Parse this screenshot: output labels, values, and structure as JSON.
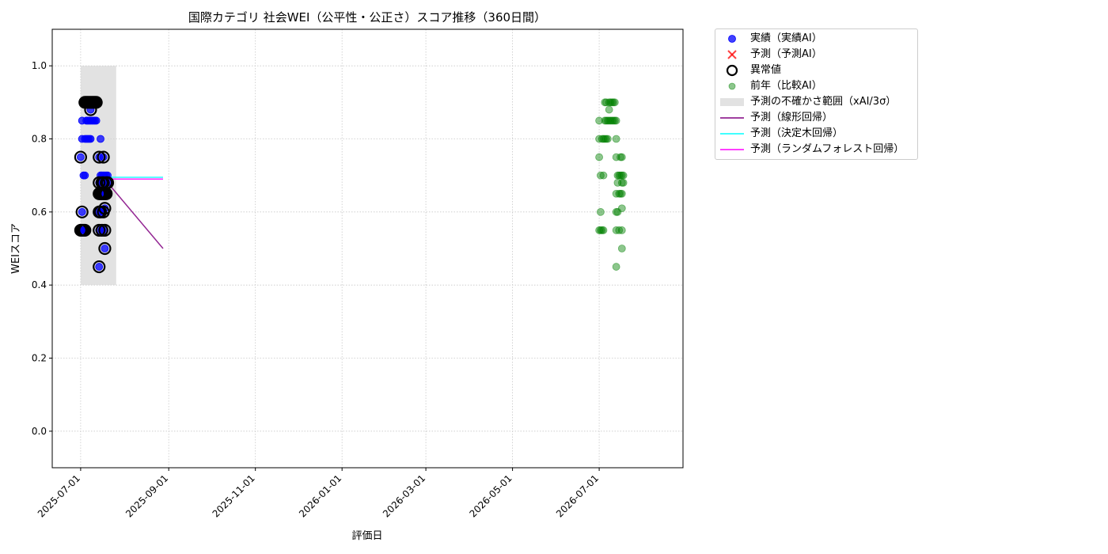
{
  "chart_data": {
    "type": "scatter",
    "title": "国際カテゴリ 社会WEI（公平性・公正さ）スコア推移（360日間）",
    "xlabel": "評価日",
    "ylabel": "WEIスコア",
    "ylim": [
      -0.1,
      1.1
    ],
    "yticks": [
      0.0,
      0.2,
      0.4,
      0.6,
      0.8,
      1.0
    ],
    "xlim": [
      "2025-06-11",
      "2026-08-29"
    ],
    "xticks": [
      "2025-07-01",
      "2025-09-01",
      "2025-11-01",
      "2026-01-01",
      "2026-03-01",
      "2026-05-01",
      "2026-07-01"
    ],
    "grid": true,
    "legend_position": "outside-right-top",
    "colors": {
      "actual": "#0000ff",
      "forecast": "#ff0000",
      "anomaly_edge": "#000000",
      "previous_year": "#008000",
      "uncertainty": "#d3d3d3",
      "linear": "#800080",
      "decision_tree": "#00ffff",
      "random_forest": "#ff00ff"
    },
    "uncertainty_band": {
      "x": [
        "2025-07-01",
        "2025-07-26"
      ],
      "y": [
        0.4,
        1.0
      ]
    },
    "legend": [
      {
        "key": "actual",
        "label": "実績（実績AI）"
      },
      {
        "key": "forecast",
        "label": "予測（予測AI）"
      },
      {
        "key": "anomaly",
        "label": "異常値"
      },
      {
        "key": "previous_year",
        "label": "前年（比較AI）"
      },
      {
        "key": "uncertainty",
        "label": "予測の不確かさ範囲（xAI/3σ）"
      },
      {
        "key": "linear",
        "label": "予測（線形回帰）"
      },
      {
        "key": "decision_tree",
        "label": "予測（決定木回帰）"
      },
      {
        "key": "random_forest",
        "label": "予測（ランダムフォレスト回帰）"
      }
    ],
    "series": [
      {
        "key": "actual",
        "points": [
          [
            "2025-07-01",
            0.75
          ],
          [
            "2025-07-01",
            0.55
          ],
          [
            "2025-07-02",
            0.85
          ],
          [
            "2025-07-02",
            0.8
          ],
          [
            "2025-07-02",
            0.55
          ],
          [
            "2025-07-02",
            0.6
          ],
          [
            "2025-07-03",
            0.7
          ],
          [
            "2025-07-03",
            0.55
          ],
          [
            "2025-07-04",
            0.9
          ],
          [
            "2025-07-04",
            0.8
          ],
          [
            "2025-07-04",
            0.7
          ],
          [
            "2025-07-04",
            0.55
          ],
          [
            "2025-07-05",
            0.9
          ],
          [
            "2025-07-05",
            0.85
          ],
          [
            "2025-07-05",
            0.8
          ],
          [
            "2025-07-06",
            0.9
          ],
          [
            "2025-07-06",
            0.85
          ],
          [
            "2025-07-06",
            0.8
          ],
          [
            "2025-07-07",
            0.9
          ],
          [
            "2025-07-07",
            0.85
          ],
          [
            "2025-07-07",
            0.8
          ],
          [
            "2025-07-08",
            0.9
          ],
          [
            "2025-07-08",
            0.85
          ],
          [
            "2025-07-08",
            0.88
          ],
          [
            "2025-07-08",
            0.8
          ],
          [
            "2025-07-09",
            0.9
          ],
          [
            "2025-07-09",
            0.85
          ],
          [
            "2025-07-10",
            0.9
          ],
          [
            "2025-07-10",
            0.85
          ],
          [
            "2025-07-11",
            0.9
          ],
          [
            "2025-07-11",
            0.85
          ],
          [
            "2025-07-12",
            0.9
          ],
          [
            "2025-07-12",
            0.85
          ],
          [
            "2025-07-15",
            0.8
          ],
          [
            "2025-07-14",
            0.75
          ],
          [
            "2025-07-14",
            0.68
          ],
          [
            "2025-07-14",
            0.65
          ],
          [
            "2025-07-14",
            0.6
          ],
          [
            "2025-07-14",
            0.55
          ],
          [
            "2025-07-14",
            0.45
          ],
          [
            "2025-07-15",
            0.7
          ],
          [
            "2025-07-15",
            0.65
          ],
          [
            "2025-07-15",
            0.6
          ],
          [
            "2025-07-16",
            0.7
          ],
          [
            "2025-07-16",
            0.68
          ],
          [
            "2025-07-16",
            0.65
          ],
          [
            "2025-07-16",
            0.55
          ],
          [
            "2025-07-17",
            0.75
          ],
          [
            "2025-07-17",
            0.7
          ],
          [
            "2025-07-17",
            0.68
          ],
          [
            "2025-07-17",
            0.65
          ],
          [
            "2025-07-17",
            0.6
          ],
          [
            "2025-07-18",
            0.7
          ],
          [
            "2025-07-18",
            0.65
          ],
          [
            "2025-07-18",
            0.61
          ],
          [
            "2025-07-18",
            0.55
          ],
          [
            "2025-07-18",
            0.5
          ],
          [
            "2025-07-19",
            0.7
          ],
          [
            "2025-07-19",
            0.68
          ],
          [
            "2025-07-19",
            0.65
          ],
          [
            "2025-07-20",
            0.7
          ],
          [
            "2025-07-20",
            0.68
          ]
        ]
      },
      {
        "key": "anomaly",
        "points": [
          [
            "2025-07-01",
            0.75
          ],
          [
            "2025-07-01",
            0.55
          ],
          [
            "2025-07-02",
            0.55
          ],
          [
            "2025-07-02",
            0.6
          ],
          [
            "2025-07-03",
            0.55
          ],
          [
            "2025-07-04",
            0.55
          ],
          [
            "2025-07-04",
            0.9
          ],
          [
            "2025-07-05",
            0.9
          ],
          [
            "2025-07-06",
            0.9
          ],
          [
            "2025-07-07",
            0.9
          ],
          [
            "2025-07-08",
            0.9
          ],
          [
            "2025-07-08",
            0.88
          ],
          [
            "2025-07-09",
            0.9
          ],
          [
            "2025-07-10",
            0.9
          ],
          [
            "2025-07-11",
            0.9
          ],
          [
            "2025-07-12",
            0.9
          ],
          [
            "2025-07-14",
            0.75
          ],
          [
            "2025-07-14",
            0.68
          ],
          [
            "2025-07-14",
            0.65
          ],
          [
            "2025-07-14",
            0.6
          ],
          [
            "2025-07-14",
            0.55
          ],
          [
            "2025-07-14",
            0.45
          ],
          [
            "2025-07-15",
            0.65
          ],
          [
            "2025-07-15",
            0.6
          ],
          [
            "2025-07-16",
            0.68
          ],
          [
            "2025-07-16",
            0.65
          ],
          [
            "2025-07-16",
            0.55
          ],
          [
            "2025-07-17",
            0.75
          ],
          [
            "2025-07-17",
            0.68
          ],
          [
            "2025-07-17",
            0.65
          ],
          [
            "2025-07-17",
            0.6
          ],
          [
            "2025-07-18",
            0.65
          ],
          [
            "2025-07-18",
            0.61
          ],
          [
            "2025-07-18",
            0.55
          ],
          [
            "2025-07-18",
            0.5
          ],
          [
            "2025-07-19",
            0.68
          ],
          [
            "2025-07-19",
            0.65
          ],
          [
            "2025-07-20",
            0.68
          ]
        ]
      },
      {
        "key": "previous_year",
        "points": [
          [
            "2026-07-01",
            0.85
          ],
          [
            "2026-07-01",
            0.8
          ],
          [
            "2026-07-01",
            0.75
          ],
          [
            "2026-07-01",
            0.55
          ],
          [
            "2026-07-02",
            0.7
          ],
          [
            "2026-07-02",
            0.6
          ],
          [
            "2026-07-02",
            0.55
          ],
          [
            "2026-07-03",
            0.8
          ],
          [
            "2026-07-03",
            0.55
          ],
          [
            "2026-07-04",
            0.8
          ],
          [
            "2026-07-04",
            0.7
          ],
          [
            "2026-07-04",
            0.55
          ],
          [
            "2026-07-05",
            0.9
          ],
          [
            "2026-07-05",
            0.85
          ],
          [
            "2026-07-05",
            0.8
          ],
          [
            "2026-07-06",
            0.9
          ],
          [
            "2026-07-06",
            0.85
          ],
          [
            "2026-07-06",
            0.8
          ],
          [
            "2026-07-07",
            0.85
          ],
          [
            "2026-07-07",
            0.8
          ],
          [
            "2026-07-08",
            0.9
          ],
          [
            "2026-07-08",
            0.88
          ],
          [
            "2026-07-08",
            0.85
          ],
          [
            "2026-07-09",
            0.9
          ],
          [
            "2026-07-09",
            0.85
          ],
          [
            "2026-07-10",
            0.9
          ],
          [
            "2026-07-10",
            0.85
          ],
          [
            "2026-07-11",
            0.9
          ],
          [
            "2026-07-11",
            0.85
          ],
          [
            "2026-07-12",
            0.9
          ],
          [
            "2026-07-12",
            0.85
          ],
          [
            "2026-07-13",
            0.85
          ],
          [
            "2026-07-13",
            0.8
          ],
          [
            "2026-07-13",
            0.75
          ],
          [
            "2026-07-13",
            0.65
          ],
          [
            "2026-07-13",
            0.6
          ],
          [
            "2026-07-13",
            0.55
          ],
          [
            "2026-07-13",
            0.45
          ],
          [
            "2026-07-14",
            0.7
          ],
          [
            "2026-07-14",
            0.68
          ],
          [
            "2026-07-14",
            0.6
          ],
          [
            "2026-07-15",
            0.7
          ],
          [
            "2026-07-15",
            0.65
          ],
          [
            "2026-07-15",
            0.55
          ],
          [
            "2026-07-16",
            0.75
          ],
          [
            "2026-07-16",
            0.7
          ],
          [
            "2026-07-16",
            0.65
          ],
          [
            "2026-07-17",
            0.75
          ],
          [
            "2026-07-17",
            0.7
          ],
          [
            "2026-07-17",
            0.68
          ],
          [
            "2026-07-17",
            0.65
          ],
          [
            "2026-07-17",
            0.61
          ],
          [
            "2026-07-17",
            0.55
          ],
          [
            "2026-07-17",
            0.5
          ],
          [
            "2026-07-18",
            0.7
          ],
          [
            "2026-07-18",
            0.68
          ]
        ]
      },
      {
        "key": "decision_tree",
        "line": [
          [
            "2025-07-20",
            0.695
          ],
          [
            "2025-08-28",
            0.695
          ]
        ]
      },
      {
        "key": "random_forest",
        "line": [
          [
            "2025-07-20",
            0.69
          ],
          [
            "2025-08-28",
            0.69
          ]
        ]
      },
      {
        "key": "linear",
        "line": [
          [
            "2025-07-20",
            0.68
          ],
          [
            "2025-08-28",
            0.5
          ]
        ]
      }
    ]
  }
}
